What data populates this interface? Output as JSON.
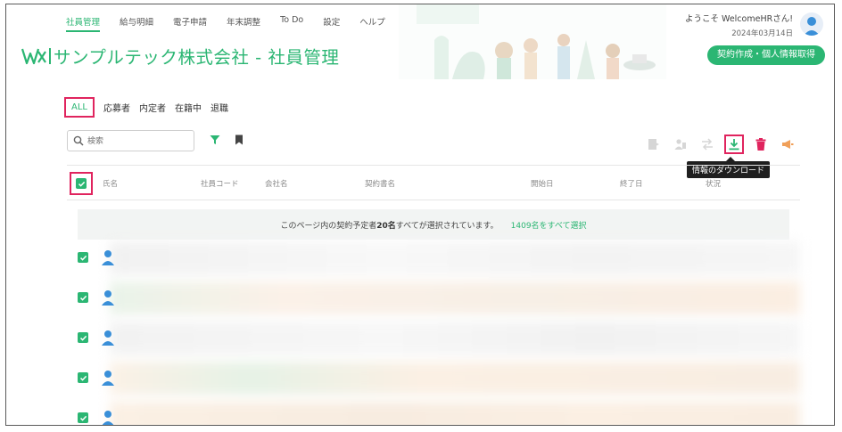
{
  "nav": {
    "items": [
      "社員管理",
      "給与明細",
      "電子申請",
      "年末調整",
      "To Do",
      "設定",
      "ヘルプ"
    ]
  },
  "header": {
    "company_title": "サンプルテック株式会社 - 社員管理",
    "greeting": "ようこそ WelcomeHRさん!",
    "date": "2024年03月14日",
    "cta_label": "契約作成・個人情報取得"
  },
  "tabs": [
    "ALL",
    "応募者",
    "内定者",
    "在籍中",
    "退職"
  ],
  "search": {
    "placeholder": "検索"
  },
  "tooltip": "情報のダウンロード",
  "table": {
    "columns": [
      "氏名",
      "社員コード",
      "会社名",
      "契約書名",
      "開始日",
      "終了日",
      "状況"
    ]
  },
  "banner": {
    "prefix": "このページ内の契約予定者",
    "count": "20名",
    "suffix": "すべてが選択されています。",
    "select_all": "1409名をすべて選択"
  },
  "colors": {
    "accent": "#2bb673",
    "highlight": "#e0245e",
    "delete": "#e0245e",
    "announce": "#f0a05a"
  }
}
